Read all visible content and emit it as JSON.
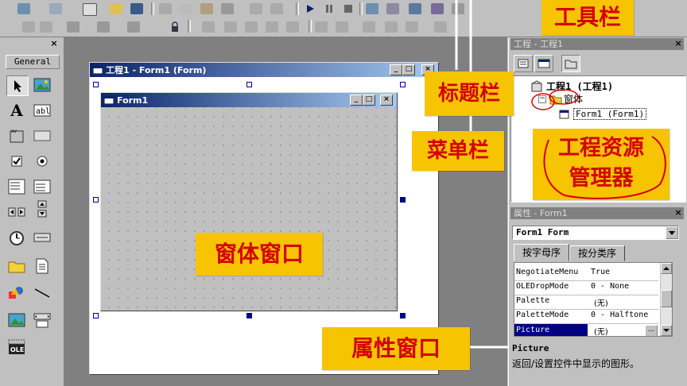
{
  "toolbox": {
    "title": "General",
    "close": "×"
  },
  "project_window": {
    "title": "工程 - 工程1",
    "close": "×",
    "tree": {
      "root": "工程1 (工程1)",
      "folder": "窗体",
      "form": "Form1 (Form1)"
    }
  },
  "properties_window": {
    "title": "属性 - Form1",
    "close": "×",
    "object_select": "Form1 Form",
    "tabs": [
      "按字母序",
      "按分类序"
    ],
    "rows": [
      {
        "name": "NegotiateMenu",
        "value": "True"
      },
      {
        "name": "OLEDropMode",
        "value": "0 - None"
      },
      {
        "name": "Palette",
        "value": "(无)"
      },
      {
        "name": "PaletteMode",
        "value": "0 - Halftone"
      },
      {
        "name": "Picture",
        "value": "(无)"
      }
    ],
    "ellipsis": "...",
    "desc_title": "Picture",
    "desc_text": "返回/设置控件中显示的图形。"
  },
  "designer_window": {
    "title": "工程1 - Form1 (Form)"
  },
  "form_window": {
    "title": "Form1"
  },
  "callouts": {
    "toolbar": "工具栏",
    "titlebar": "标题栏",
    "menubar": "菜单栏",
    "project_explorer_line1": "工程资源",
    "project_explorer_line2": "管理器",
    "form_window": "窗体窗口",
    "properties_window": "属性窗口"
  },
  "colors": {
    "callout_bg": "#f6c400",
    "callout_text": "#d40000",
    "titlebar_active": "#0a246a",
    "selection": "#000080"
  }
}
